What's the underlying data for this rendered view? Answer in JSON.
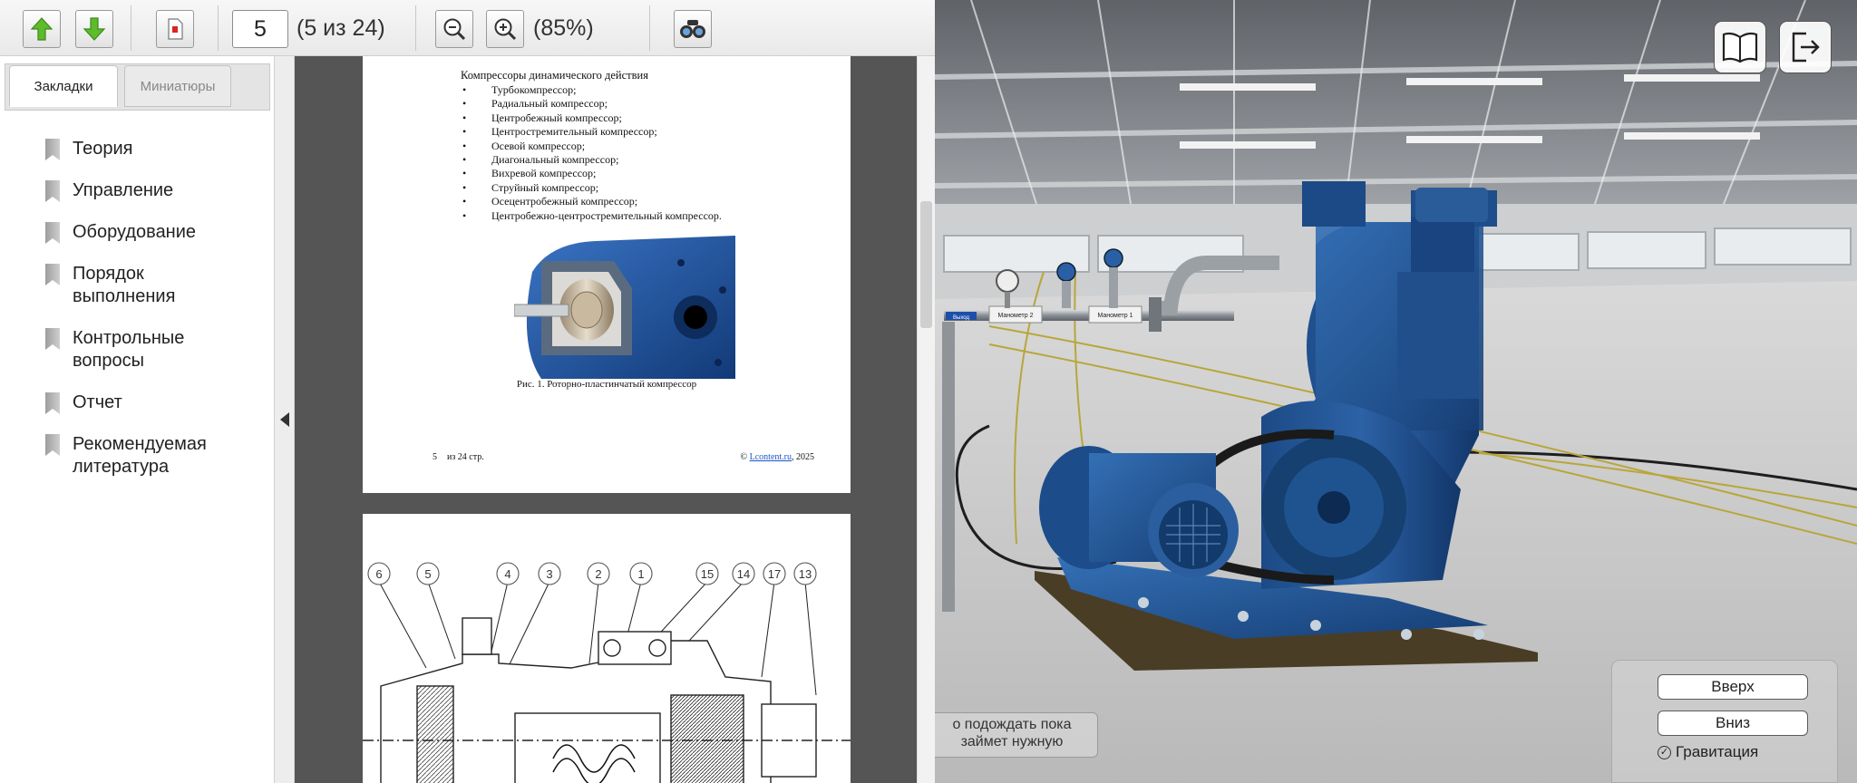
{
  "toolbar": {
    "page_input_value": "5",
    "page_counter": "(5 из 24)",
    "zoom_level": "(85%)"
  },
  "sidebar": {
    "tabs": [
      {
        "label": "Закладки",
        "active": true
      },
      {
        "label": "Миниатюры",
        "active": false
      }
    ],
    "bookmarks": [
      {
        "label": "Теория"
      },
      {
        "label": "Управление"
      },
      {
        "label": "Оборудование"
      },
      {
        "label": "Порядок выполнения"
      },
      {
        "label": "Контрольные вопросы"
      },
      {
        "label": "Отчет"
      },
      {
        "label": "Рекомендуемая литература"
      }
    ]
  },
  "document": {
    "section_title": "Компрессоры динамического действия",
    "list_items": [
      "Турбокомпрессор;",
      "Радиальный компрессор;",
      "Центробежный компрессор;",
      "Центростремительный компрессор;",
      "Осевой компрессор;",
      "Диагональный компрессор;",
      "Вихревой компрессор;",
      "Струйный компрессор;",
      "Осецентробежный компрессор;",
      "Центробежно-центростремительный компрессор."
    ],
    "figure_caption": "Рис. 1. Роторно-пластинчатый компрессор",
    "footer": {
      "page_number": "5",
      "page_of": "из 24 стр.",
      "copyright_prefix": "©",
      "copyright_link": "Lcontent.ru",
      "copyright_year": ", 2025"
    },
    "drawing_callouts": [
      "6",
      "5",
      "4",
      "3",
      "2",
      "1",
      "15",
      "14",
      "17",
      "13"
    ]
  },
  "scene": {
    "gauge_labels": [
      "Манометр 2",
      "Манометр 1"
    ],
    "pipe_tag": "Выход",
    "hint_text": "о подождать пока займет нужную",
    "controls": {
      "up_label": "Вверх",
      "down_label": "Вниз",
      "gravity_label": "Гравитация",
      "gravity_checked": true
    }
  },
  "colors": {
    "machine_blue": "#1f4e87",
    "toolbar_arrow_green": "#5dbb2c",
    "doc_background": "#555555"
  }
}
